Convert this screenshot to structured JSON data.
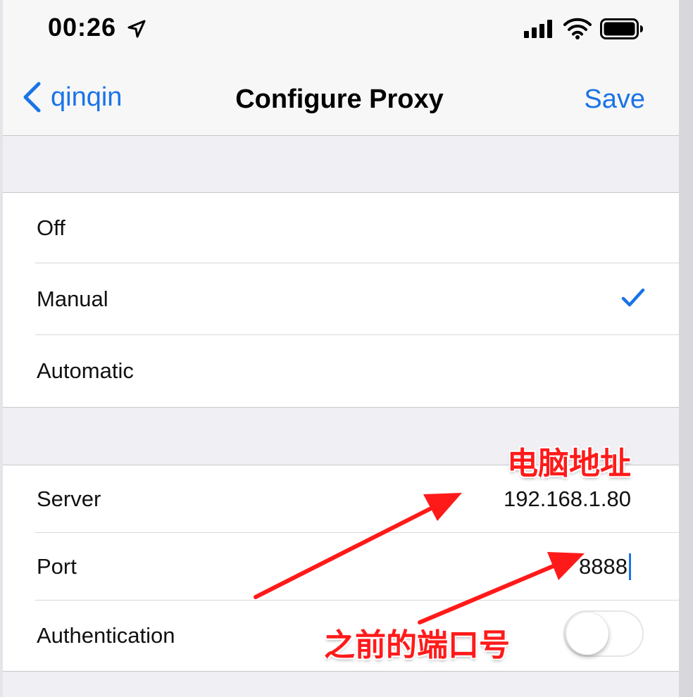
{
  "status_bar": {
    "time": "00:26",
    "icons": [
      "location-arrow-icon",
      "cellular-signal-icon",
      "wifi-icon",
      "battery-icon"
    ]
  },
  "nav": {
    "back_label": "qinqin",
    "title": "Configure Proxy",
    "save_label": "Save"
  },
  "proxy_modes": {
    "items": [
      {
        "label": "Off",
        "selected": false
      },
      {
        "label": "Manual",
        "selected": true
      },
      {
        "label": "Automatic",
        "selected": false
      }
    ]
  },
  "manual_settings": {
    "server_label": "Server",
    "server_value": "192.168.1.80",
    "port_label": "Port",
    "port_value": "8888",
    "authentication_label": "Authentication",
    "authentication_enabled": false
  },
  "annotations": {
    "server_note": "电脑地址",
    "port_note": "之前的端口号",
    "color": "#ff1a1a"
  },
  "colors": {
    "accent": "#1a73e8",
    "background": "#efeff4"
  }
}
